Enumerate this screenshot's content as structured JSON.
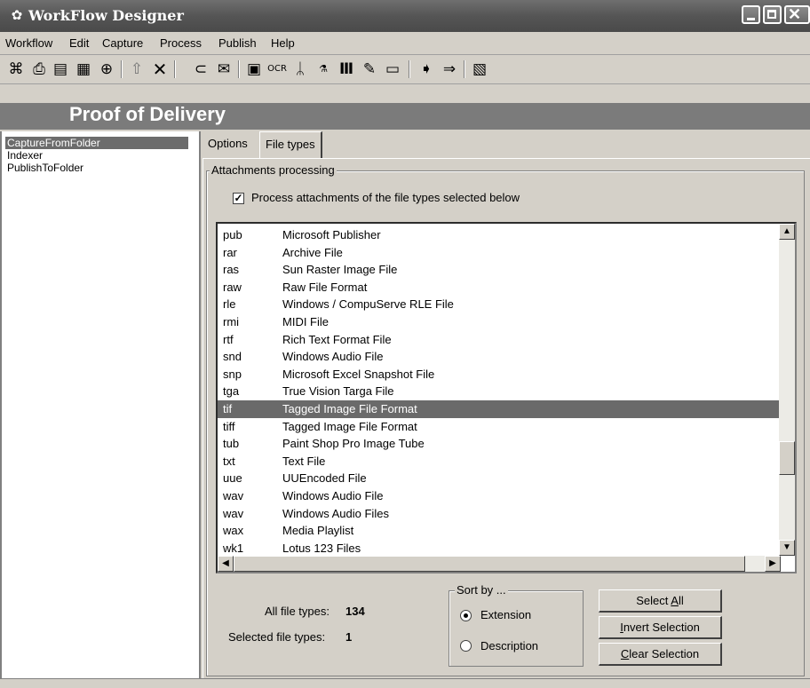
{
  "window": {
    "title": "WorkFlow Designer"
  },
  "menu": [
    "Workflow",
    "Edit",
    "Capture",
    "Process",
    "Publish",
    "Help"
  ],
  "banner": "Proof of Delivery",
  "tree": [
    "CaptureFromFolder",
    "Indexer",
    "PublishToFolder"
  ],
  "tabs": [
    "Options",
    "File types"
  ],
  "group_label": "Attachments processing",
  "process_checkbox": {
    "label": "Process attachments of the file types selected below",
    "checked": true
  },
  "file_types": [
    {
      "ext": "pub",
      "desc": "Microsoft Publisher"
    },
    {
      "ext": "rar",
      "desc": "Archive File"
    },
    {
      "ext": "ras",
      "desc": "Sun Raster Image File"
    },
    {
      "ext": "raw",
      "desc": "Raw File Format"
    },
    {
      "ext": "rle",
      "desc": "Windows / CompuServe RLE File"
    },
    {
      "ext": "rmi",
      "desc": "MIDI File"
    },
    {
      "ext": "rtf",
      "desc": "Rich Text Format File"
    },
    {
      "ext": "snd",
      "desc": "Windows Audio File"
    },
    {
      "ext": "snp",
      "desc": "Microsoft Excel Snapshot File"
    },
    {
      "ext": "tga",
      "desc": "True Vision Targa File"
    },
    {
      "ext": "tif",
      "desc": "Tagged Image File Format",
      "selected": true
    },
    {
      "ext": "tiff",
      "desc": "Tagged Image File Format"
    },
    {
      "ext": "tub",
      "desc": "Paint Shop Pro Image Tube"
    },
    {
      "ext": "txt",
      "desc": "Text File"
    },
    {
      "ext": "uue",
      "desc": "UUEncoded File"
    },
    {
      "ext": "wav",
      "desc": "Windows Audio File"
    },
    {
      "ext": "wav",
      "desc": "Windows Audio Files"
    },
    {
      "ext": "wax",
      "desc": "Media Playlist"
    },
    {
      "ext": "wk1",
      "desc": "Lotus 123 Files"
    }
  ],
  "stats": {
    "all_label": "All file types:",
    "all_value": "134",
    "selected_label": "Selected file types:",
    "selected_value": "1"
  },
  "sort": {
    "label": "Sort by ...",
    "options": [
      "Extension",
      "Description"
    ],
    "selected": "Extension"
  },
  "buttons": {
    "select_all": {
      "pre": "Select ",
      "key": "A",
      "post": "ll"
    },
    "invert": {
      "pre": "",
      "key": "I",
      "post": "nvert Selection"
    },
    "clear": {
      "pre": "",
      "key": "C",
      "post": "lear Selection"
    }
  },
  "toolbar_icons": [
    "new-icon",
    "open-icon",
    "save-icon",
    "save-as-icon",
    "lock-icon",
    "up-arrow-icon",
    "delete-icon",
    "folder-capture-icon",
    "mail-capture-icon",
    "scan-icon",
    "ocr-icon",
    "pdf-icon",
    "meta-icon",
    "barcode-icon",
    "sign-icon",
    "image-icon",
    "publish-icon",
    "publish-copy-icon",
    "preview-icon"
  ]
}
